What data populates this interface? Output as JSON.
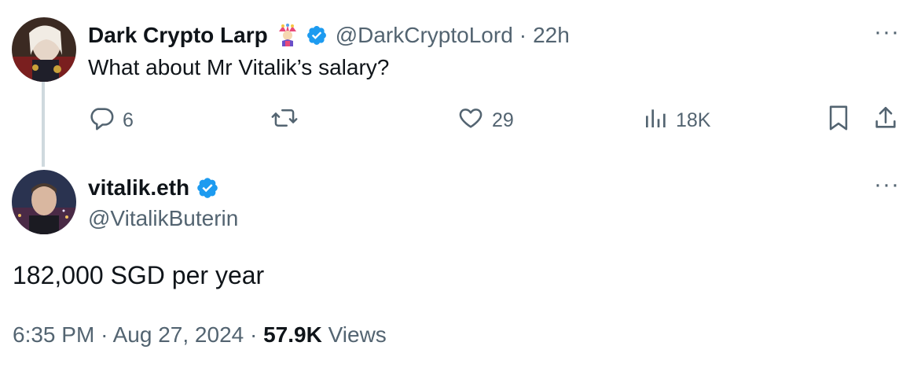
{
  "reply_to": {
    "display_name": "Dark Crypto Larp",
    "badge_emoji": "jester-emoji",
    "handle": "@DarkCryptoLord",
    "separator": "·",
    "time": "22h",
    "text": "What about Mr Vitalik’s salary?",
    "more": "···",
    "stats": {
      "replies": "6",
      "likes": "29",
      "views": "18K"
    }
  },
  "main_tweet": {
    "display_name": "vitalik.eth",
    "handle": "@VitalikButerin",
    "more": "···",
    "text": "182,000 SGD per year",
    "time": "6:35 PM",
    "separator1": "·",
    "date": "Aug 27, 2024",
    "separator2": "·",
    "views_count": "57.9K",
    "views_label": "Views"
  },
  "colors": {
    "verified": "#1d9bf0",
    "secondary_text": "#536471",
    "primary_text": "#0f1419",
    "thread_line": "#cfd9de"
  }
}
